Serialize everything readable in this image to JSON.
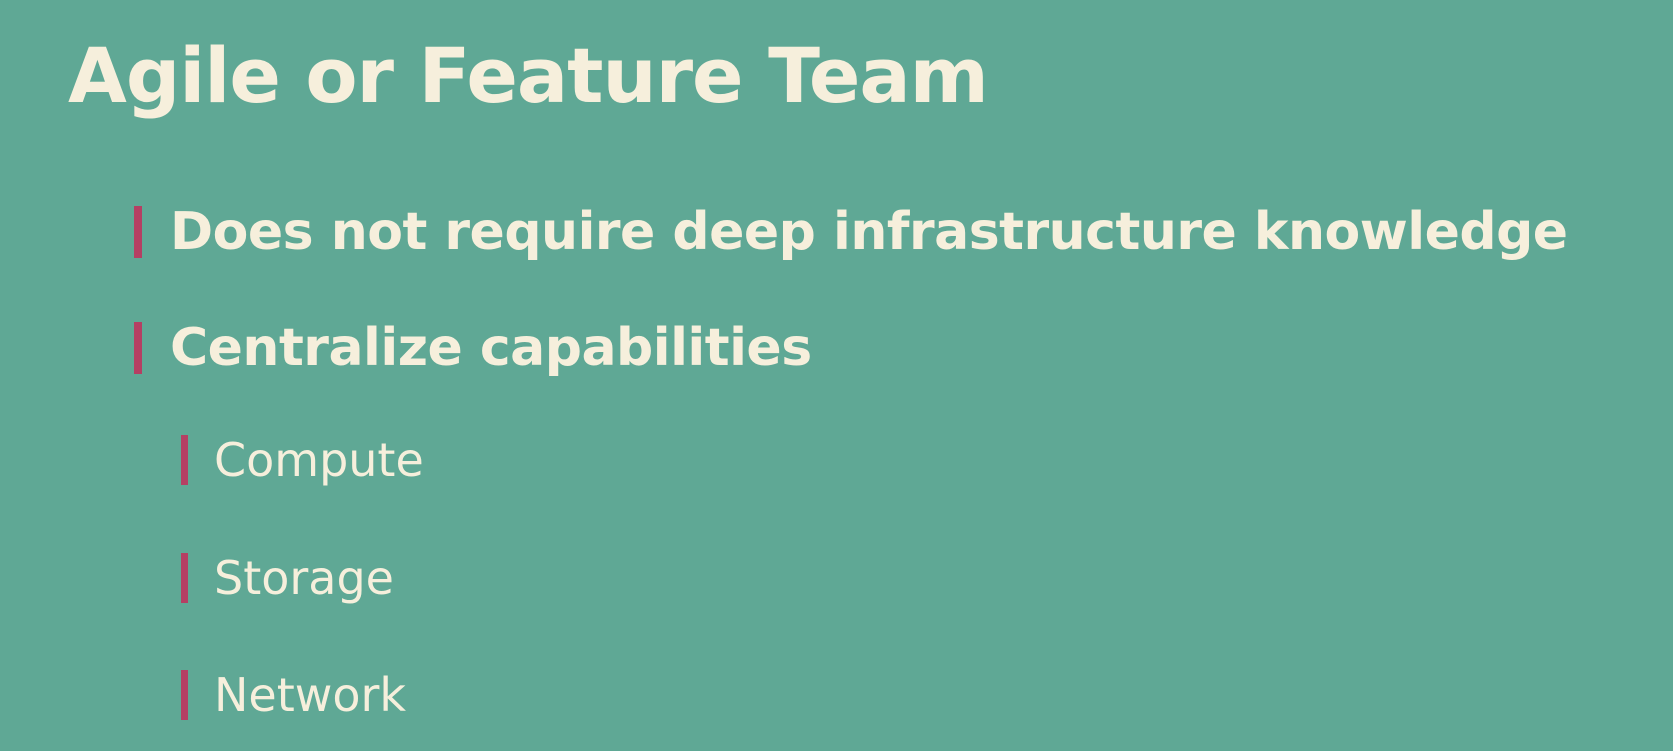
{
  "slide": {
    "title": "Agile or Feature Team",
    "bullets": [
      {
        "text": "Does not require deep infrastructure knowledge",
        "level": 1
      },
      {
        "text": "Centralize capabilities",
        "level": 1
      },
      {
        "text": "Compute",
        "level": 2
      },
      {
        "text": "Storage",
        "level": 2
      },
      {
        "text": "Network",
        "level": 2
      }
    ]
  },
  "colors": {
    "background": "#5fa895",
    "text": "#f6efdc",
    "bullet_marker": "#b53f63"
  }
}
